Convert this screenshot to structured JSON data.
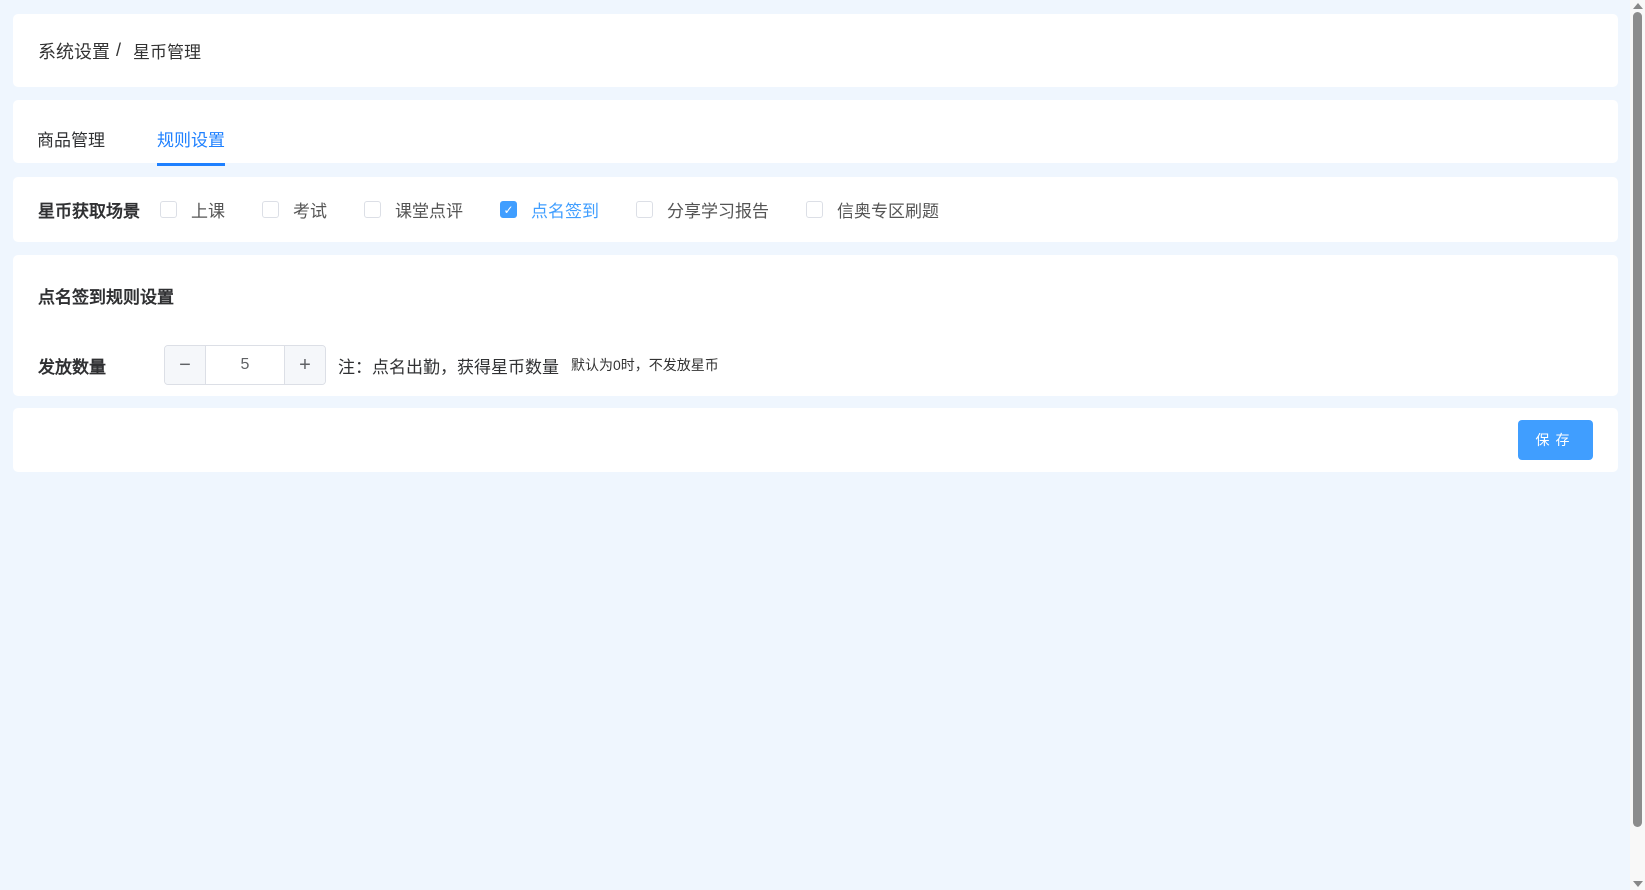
{
  "breadcrumb": {
    "parent": "系统设置",
    "separator": "/",
    "current": "星币管理"
  },
  "tabs": [
    {
      "label": "商品管理",
      "active": false
    },
    {
      "label": "规则设置",
      "active": true
    }
  ],
  "scene": {
    "label": "星币获取场景",
    "options": [
      {
        "label": "上课",
        "checked": false
      },
      {
        "label": "考试",
        "checked": false
      },
      {
        "label": "课堂点评",
        "checked": false
      },
      {
        "label": "点名签到",
        "checked": true
      },
      {
        "label": "分享学习报告",
        "checked": false
      },
      {
        "label": "信奥专区刷题",
        "checked": false
      }
    ]
  },
  "rule": {
    "title": "点名签到规则设置",
    "quantity_label": "发放数量",
    "quantity_value": "5",
    "minus": "−",
    "plus": "+",
    "note": "注：点名出勤，获得星币数量",
    "hint": "默认为0时，不发放星币"
  },
  "footer": {
    "save_label": "保存"
  },
  "colors": {
    "accent": "#409eff",
    "tab_active": "#1e80ff",
    "background": "#eff6fe"
  }
}
